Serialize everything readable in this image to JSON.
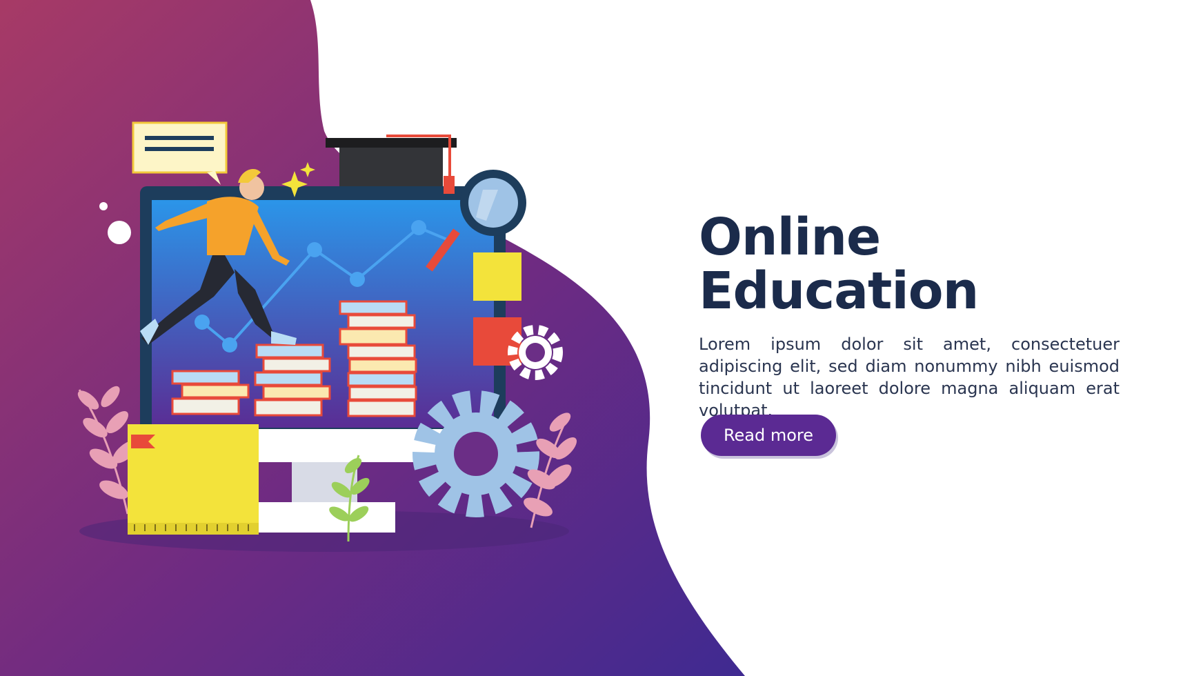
{
  "hero": {
    "title_line1": "Online",
    "title_line2": "Education",
    "description": "Lorem ipsum dolor sit amet, consectetuer adipiscing elit, sed diam nonummy nibh euismod tincidunt ut laoreet dolore magna aliquam erat volutpat.",
    "cta_label": "Read more"
  },
  "colors": {
    "gradient_top": "#a73a66",
    "gradient_bottom": "#3f2a91",
    "title": "#1b2b4b",
    "button": "#5b2a93",
    "screen_top": "#2b95e9",
    "screen_bottom": "#5a2d94"
  },
  "illustration": {
    "elements": [
      "speech-bubble-icon",
      "graduation-cap-icon",
      "magnifier-icon",
      "gear-icon",
      "book-stack-icon",
      "chart-line-icon",
      "plant-icon",
      "ruler-icon"
    ]
  }
}
